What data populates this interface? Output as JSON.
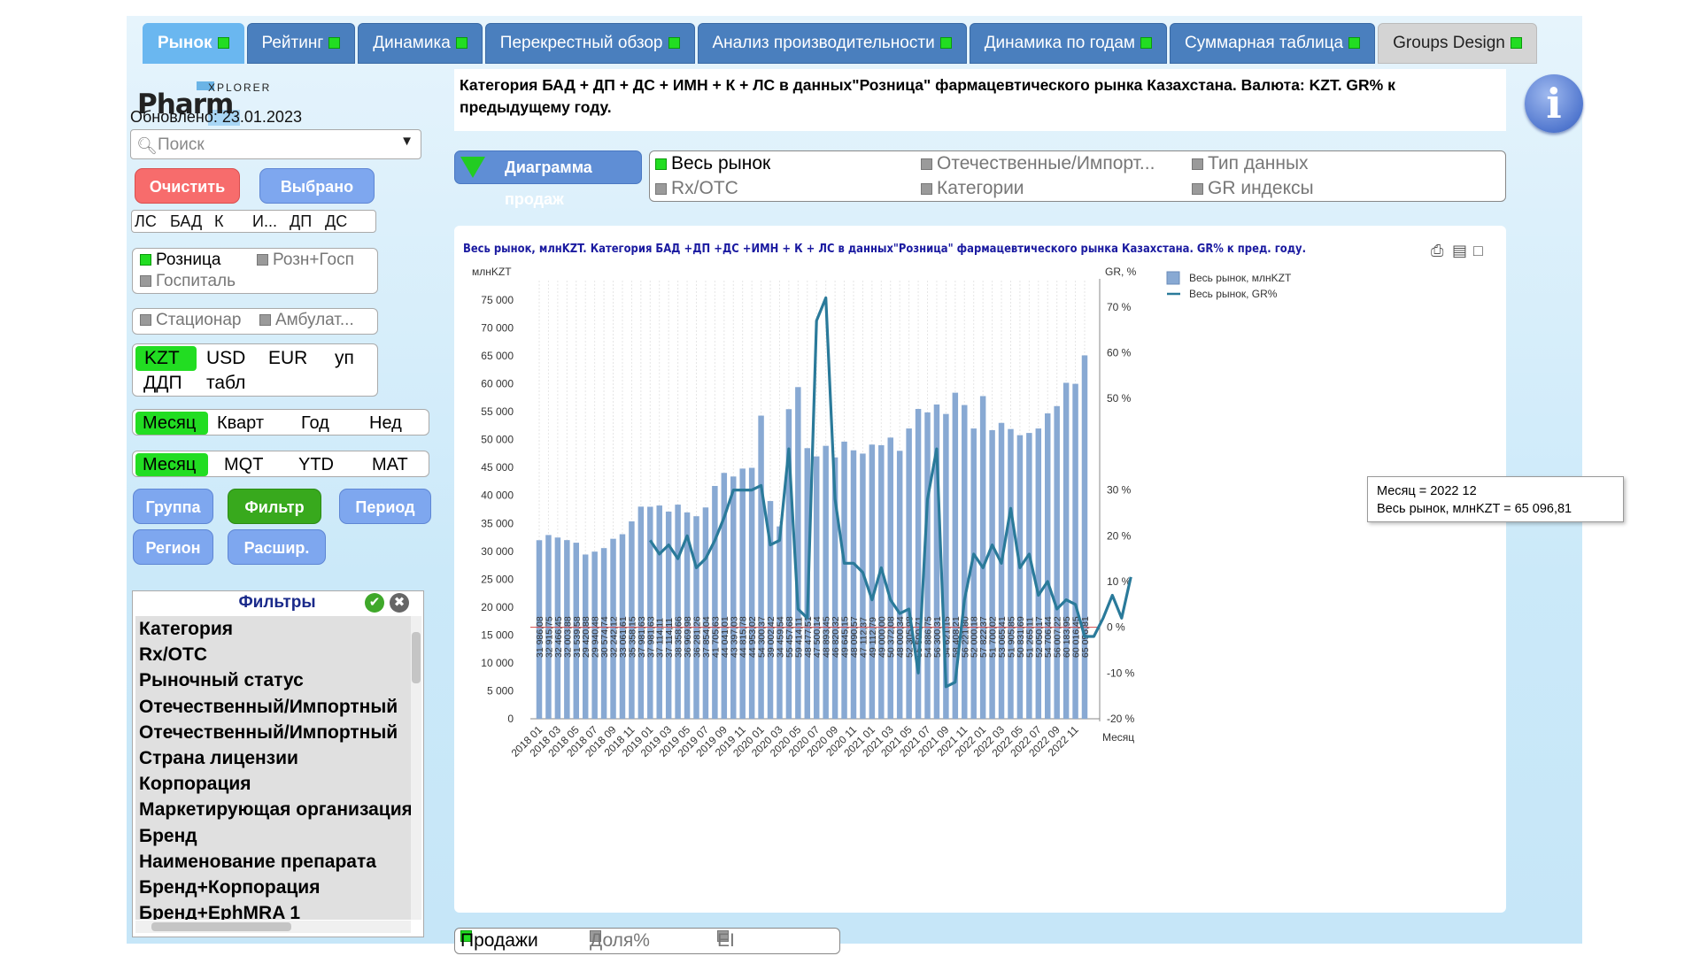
{
  "tabs": [
    {
      "label": "Рынок",
      "active": true
    },
    {
      "label": "Рейтинг"
    },
    {
      "label": "Динамика"
    },
    {
      "label": "Перекрестный обзор"
    },
    {
      "label": "Анализ производительности"
    },
    {
      "label": "Динамика по годам"
    },
    {
      "label": "Суммарная таблица"
    },
    {
      "label": "Groups Design",
      "grey": true
    }
  ],
  "logo": {
    "text": "Pharm",
    "sub": "XPLORER"
  },
  "updated": "Обновлено: 23.01.2023",
  "search": {
    "placeholder": "Поиск"
  },
  "buttons": {
    "clear": "Очистить",
    "selected": "Выбрано",
    "group": "Группа",
    "filter": "Фильтр",
    "period": "Период",
    "region": "Регион",
    "expand": "Расшир."
  },
  "categories_chips": [
    "ЛС",
    "БАД",
    "К",
    "И...",
    "ДП",
    "ДС"
  ],
  "channel": {
    "retail": "Розница",
    "retail_hosp": "Розн+Госп",
    "hospital": "Госпиталь"
  },
  "care": {
    "inpatient": "Стационар",
    "outpatient": "Амбулат..."
  },
  "currency": {
    "kzt": "KZT",
    "usd": "USD",
    "eur": "EUR",
    "up": "уп",
    "ddp": "ДДП",
    "tabl": "табл"
  },
  "granularity": {
    "month": "Месяц",
    "quarter": "Кварт",
    "year": "Год",
    "week": "Нед"
  },
  "period_mode": {
    "month": "Месяц",
    "mqt": "MQT",
    "ytd": "YTD",
    "mat": "MAT"
  },
  "filters": {
    "title": "Фильтры",
    "items": [
      "Категория",
      "Rx/OTC",
      "Рыночный статус",
      "Отечественный/Импортный",
      "Отечественный/Импортный",
      "Страна лицензии",
      "Корпорация",
      "Маркетирующая организация",
      "Бренд",
      "Наименование препарата",
      "Бренд+Корпорация",
      "Бренд+EphMRA 1"
    ]
  },
  "title_text": "Категория БАД + ДП + ДС + ИМН + К + ЛС в данных\"Розница\" фармацевтического рынка Казахстана. Валюта: KZT. GR% к предыдущему году.",
  "sales_button": "Диаграмма продаж",
  "selectors": {
    "all_market": "Весь рынок",
    "domestic_import": "Отечественные/Импорт...",
    "data_type": "Тип данных",
    "rx_otc": "Rx/OTC",
    "categories": "Категории",
    "gr_index": "GR индексы"
  },
  "bottom_selector": {
    "sales": "Продажи",
    "share": "Доля%",
    "ei": "EI"
  },
  "tooltip": {
    "line1": "Месяц = 2022 12",
    "line2": "Весь рынок, млнKZT = 65 096,81"
  },
  "colors": {
    "bar": "#88a9d3",
    "line": "#2a7a9a",
    "zero_line": "#d44444",
    "title": "#1a1aa0"
  },
  "chart_data": {
    "type": "bar",
    "title": "Весь рынок, млнKZT. Категория БАД +ДП +ДС +ИМН + К + ЛС в данных\"Розница\" фармацевтического рынка Казахстана. GR% к пред. году.",
    "ylabel": "млнKZT",
    "y2label": "GR, %",
    "xlabel": "Месяц",
    "ylim": [
      0,
      75000
    ],
    "y2lim": [
      -20,
      75
    ],
    "yticks": [
      "75 000",
      "70 000",
      "65 000",
      "60 000",
      "55 000",
      "50 000",
      "45 000",
      "40 000",
      "35 000",
      "30 000",
      "25 000",
      "20 000",
      "15 000",
      "10 000",
      "5 000",
      "0"
    ],
    "y2ticks": [
      "70 %",
      "60 %",
      "50 %",
      "30 %",
      "20 %",
      "10 %",
      "0 %",
      "-10 %",
      "-20 %"
    ],
    "x_tick_labels": [
      "2018 01",
      "2018 03",
      "2018 05",
      "2018 07",
      "2018 09",
      "2018 11",
      "2019 01",
      "2019 03",
      "2019 05",
      "2019 07",
      "2019 09",
      "2019 11",
      "2020 01",
      "2020 03",
      "2020 05",
      "2020 07",
      "2020 09",
      "2020 11",
      "2021 01",
      "2021 03",
      "2021 05",
      "2021 07",
      "2021 09",
      "2021 11",
      "2022 01",
      "2022 03",
      "2022 05",
      "2022 07",
      "2022 09",
      "2022 11"
    ],
    "legend": {
      "position": "top-right",
      "bar": "Весь рынок, млнKZT",
      "line": "Весь рынок, GR%"
    },
    "series": [
      {
        "name": "Весь рынок, млнKZT",
        "type": "bar",
        "values": [
          31986,
          32915,
          32466,
          32003,
          31539,
          29420,
          29940,
          30574,
          32242,
          33061,
          35358,
          38000,
          37981,
          38200,
          37114,
          38359,
          36969,
          36281,
          37854,
          41705,
          44041,
          43397,
          44815,
          44953,
          54300,
          39000,
          34459,
          55458,
          59414,
          48477,
          47000,
          48890,
          46820,
          49645,
          48090,
          47500,
          49113,
          49000,
          50370,
          48000,
          52000,
          55500,
          54886,
          56300,
          54600,
          58409,
          56200,
          52000,
          57800,
          51700,
          53000,
          51900,
          50800,
          51200,
          52000,
          54700,
          56007,
          60184,
          60000,
          65097
        ],
        "labels": [
          "31 986,08",
          "32 915,75",
          "32 466,45",
          "32 003,88",
          "31 539,58",
          "29 420,88",
          "29 940,48",
          "30 574,74",
          "32 242,12",
          "33 061,61",
          "35 358,15",
          "37 981,63",
          "37 981,63",
          "37 114,11",
          "37 114,11",
          "38 358,66",
          "36 969,98",
          "36 281,26",
          "37 854,04",
          "41 705,63",
          "44 041,01",
          "43 397,03",
          "44 815,78",
          "44 953,02",
          "54 300,37",
          "39 002,42",
          "34 459,54",
          "55 457,68",
          "59 414,11",
          "48 477,51",
          "47 500,14",
          "48 893,45",
          "46 820,32",
          "49 645,15",
          "48 090,57",
          "47 112,37",
          "49 112,79",
          "49 000,00",
          "50 372,08",
          "48 000,34",
          "52 305,98",
          "55 500,71",
          "54 886,75",
          "56 300,31",
          "54 621,15",
          "58 408,21",
          "56 221,80",
          "52 000,18",
          "57 822,37",
          "51 700,02",
          "53 065,41",
          "51 905,85",
          "50 831,69",
          "51 265,11",
          "52 050,17",
          "54 706,44",
          "56 007,22",
          "60 183,95",
          "60 016,45",
          "65 096,81"
        ]
      },
      {
        "name": "Весь рынок, GR%",
        "type": "line",
        "start_index": 12,
        "values": [
          19,
          16,
          18,
          15,
          20,
          13,
          15,
          19,
          24,
          30,
          30,
          30,
          31,
          18,
          19,
          39,
          4,
          2,
          67,
          72,
          28,
          14,
          14,
          12,
          6,
          13,
          6,
          3,
          4,
          -10,
          28,
          39,
          -13,
          -12,
          6,
          16,
          13,
          18,
          14,
          26,
          13,
          16,
          7,
          10,
          4,
          6,
          5,
          -2,
          -2,
          2,
          7,
          2,
          11
        ]
      }
    ]
  }
}
